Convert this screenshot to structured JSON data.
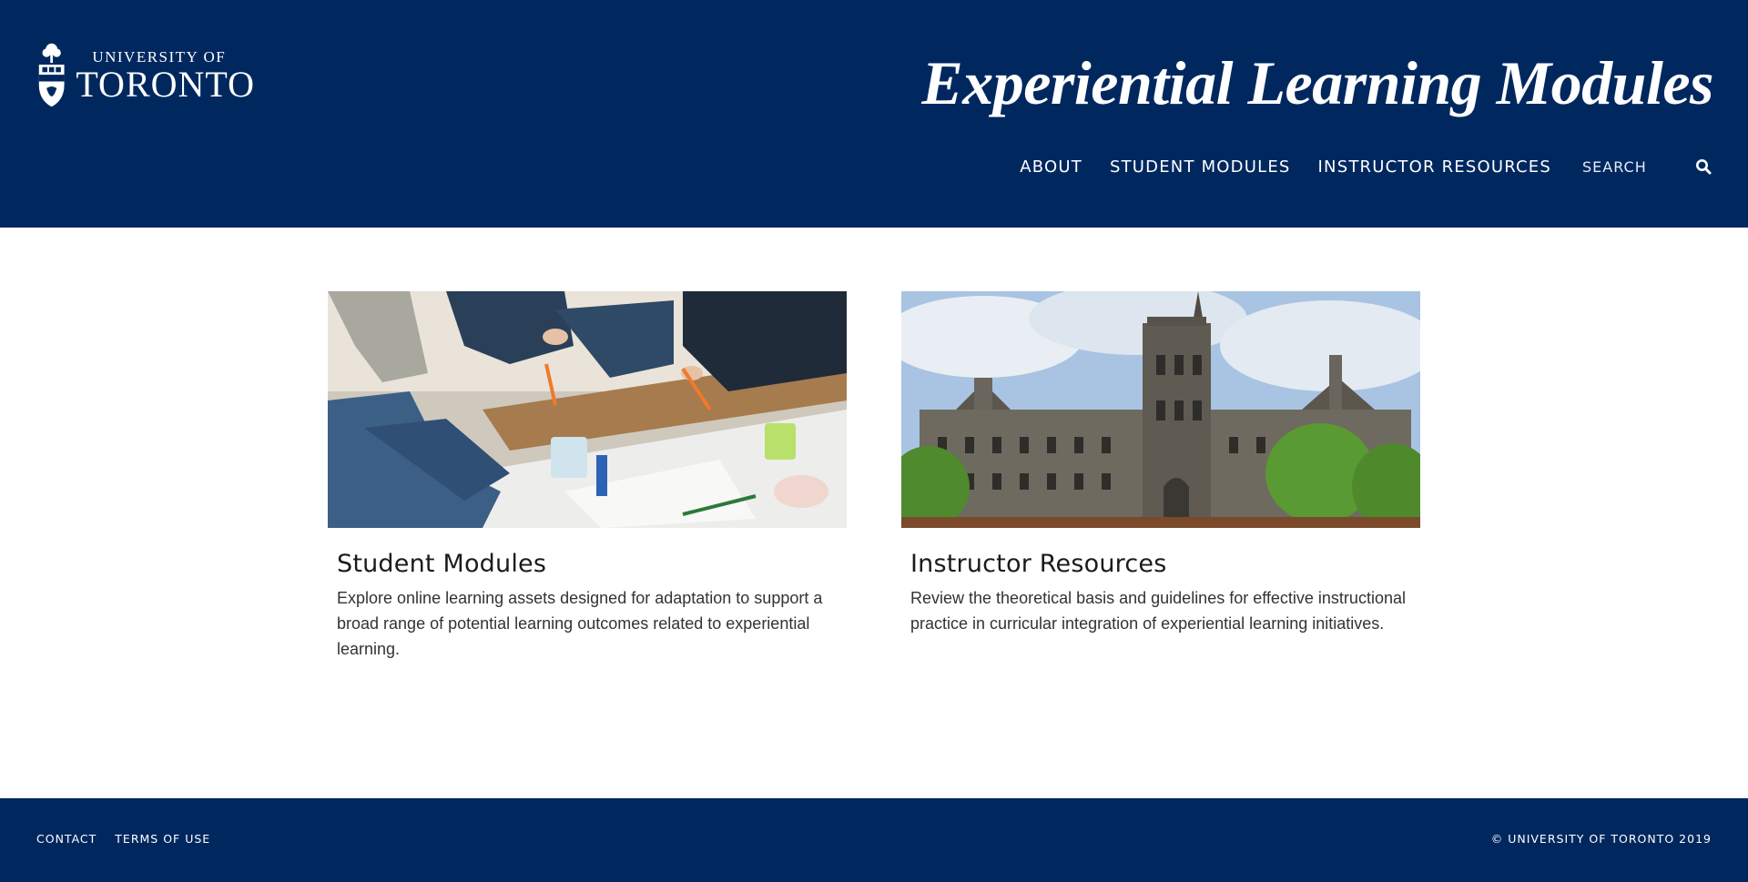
{
  "colors": {
    "brand_navy": "#00285f",
    "text_dark": "#1b1b1b",
    "text_body": "#333333",
    "white": "#ffffff"
  },
  "logo": {
    "line1": "UNIVERSITY OF",
    "line2": "TORONTO",
    "icon": "university-crest-icon"
  },
  "site_title": "Experiential Learning Modules",
  "nav": {
    "items": [
      {
        "label": "ABOUT"
      },
      {
        "label": "STUDENT MODULES"
      },
      {
        "label": "INSTRUCTOR RESOURCES"
      }
    ],
    "search": {
      "placeholder": "SEARCH",
      "value": "",
      "icon": "search-icon"
    }
  },
  "cards": [
    {
      "title": "Student Modules",
      "description": "Explore online learning assets designed for adaptation to support a broad range of potential learning outcomes related to experiential learning.",
      "image": "students-collaborating-photo"
    },
    {
      "title": "Instructor Resources",
      "description": "Review the theoretical basis and guidelines for effective instructional practice in curricular integration of experiential learning initiatives.",
      "image": "university-college-building-photo"
    }
  ],
  "footer": {
    "links": [
      {
        "label": "CONTACT"
      },
      {
        "label": "TERMS OF USE"
      }
    ],
    "copyright": "© UNIVERSITY OF TORONTO 2019"
  }
}
